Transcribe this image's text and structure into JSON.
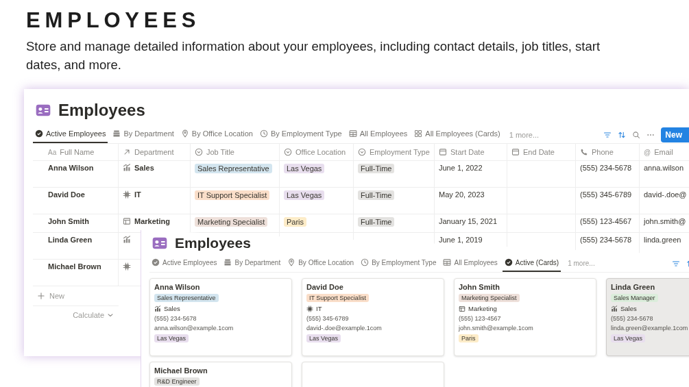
{
  "header": {
    "title": "EMPLOYEES",
    "description": "Store and manage detailed information about your employees, including contact details, job titles, start dates, and more."
  },
  "database": {
    "title": "Employees",
    "views": [
      {
        "label": "Active Employees",
        "selected": true
      },
      {
        "label": "By Department",
        "selected": false
      },
      {
        "label": "By Office Location",
        "selected": false
      },
      {
        "label": "By Employment Type",
        "selected": false
      },
      {
        "label": "All Employees",
        "selected": false
      },
      {
        "label": "All Employees (Cards)",
        "selected": false
      }
    ],
    "more": "1 more...",
    "new_button": "New",
    "columns": [
      {
        "label": "Full Name",
        "kind": "text",
        "prefix": "Aa"
      },
      {
        "label": "Department",
        "kind": "relation"
      },
      {
        "label": "Job Title",
        "kind": "select"
      },
      {
        "label": "Office Location",
        "kind": "select"
      },
      {
        "label": "Employment Type",
        "kind": "select"
      },
      {
        "label": "Start Date",
        "kind": "date"
      },
      {
        "label": "End Date",
        "kind": "date"
      },
      {
        "label": "Phone",
        "kind": "phone"
      },
      {
        "label": "Email",
        "kind": "email",
        "prefix": "@"
      }
    ],
    "rows": [
      {
        "name": "Anna Wilson",
        "department": {
          "label": "Sales",
          "kind": "sales"
        },
        "job_title": {
          "label": "Sales Representative",
          "color": "#d3e5ef"
        },
        "office": {
          "label": "Las Vegas",
          "color": "#e8deee"
        },
        "employment_type": {
          "label": "Full-Time",
          "color": "#e3e2e0"
        },
        "start_date": "June 1, 2022",
        "phone": "(555) 234-5678",
        "email": "anna.wilson"
      },
      {
        "name": "David Doe",
        "department": {
          "label": "IT",
          "kind": "it"
        },
        "job_title": {
          "label": "IT Support Specialist",
          "color": "#fadec9"
        },
        "office": {
          "label": "Las Vegas",
          "color": "#e8deee"
        },
        "employment_type": {
          "label": "Full-Time",
          "color": "#e3e2e0"
        },
        "start_date": "May 20, 2023",
        "phone": "(555) 345-6789",
        "email": "david-.doe@"
      },
      {
        "name": "John Smith",
        "department": {
          "label": "Marketing",
          "kind": "marketing"
        },
        "job_title": {
          "label": "Marketing Specialist",
          "color": "#eee0da"
        },
        "office": {
          "label": "Paris",
          "color": "#fdecc8"
        },
        "employment_type": {
          "label": "Full-Time",
          "color": "#e3e2e0"
        },
        "start_date": "January 15, 2021",
        "phone": "(555) 123-4567",
        "email": "john.smith@"
      },
      {
        "name": "Linda Green",
        "department": {
          "kind": "sales"
        },
        "start_date": "June 1, 2019",
        "phone": "(555) 234-5678",
        "email": "linda.green"
      },
      {
        "name": "Michael Brown",
        "department": {
          "kind": "it"
        }
      }
    ],
    "add_row": "New",
    "calculate": "Calculate"
  },
  "overlay": {
    "title": "Employees",
    "views": [
      {
        "label": "Active Employees",
        "selected": false
      },
      {
        "label": "By Department",
        "selected": false
      },
      {
        "label": "By Office Location",
        "selected": false
      },
      {
        "label": "By Employment Type",
        "selected": false
      },
      {
        "label": "All Employees",
        "selected": false
      },
      {
        "label": "Active (Cards)",
        "selected": true
      }
    ],
    "more": "1 more...",
    "cards": [
      {
        "kind": "person",
        "hovered": false,
        "name": "Anna Wilson",
        "job_title": {
          "label": "Sales Representative",
          "color": "#d3e5ef"
        },
        "department": {
          "label": "Sales",
          "kind": "sales"
        },
        "phone": "(555) 234-5678",
        "email": "anna.wilson@example.1com",
        "office": {
          "label": "Las Vegas",
          "color": "#e8deee"
        }
      },
      {
        "kind": "person",
        "hovered": false,
        "name": "David Doe",
        "job_title": {
          "label": "IT Support Specialist",
          "color": "#fadec9"
        },
        "department": {
          "label": "IT",
          "kind": "it"
        },
        "phone": "(555) 345-6789",
        "email": "david-.doe@example.1com",
        "office": {
          "label": "Las Vegas",
          "color": "#e8deee"
        }
      },
      {
        "kind": "person",
        "hovered": false,
        "name": "John Smith",
        "job_title": {
          "label": "Marketing Specialist",
          "color": "#eee0da"
        },
        "department": {
          "label": "Marketing",
          "kind": "marketing"
        },
        "phone": "(555) 123-4567",
        "email": "john.smith@example.1com",
        "office": {
          "label": "Paris",
          "color": "#fdecc8"
        }
      },
      {
        "kind": "person",
        "hovered": true,
        "name": "Linda Green",
        "job_title": {
          "label": "Sales Manager",
          "color": "#dbeddb"
        },
        "department": {
          "label": "Sales",
          "kind": "sales"
        },
        "phone": "(555) 234-5678",
        "email": "linda.green@example.1com",
        "office": {
          "label": "Las Vegas",
          "color": "#e8deee"
        }
      },
      {
        "kind": "person",
        "hovered": false,
        "name": "Michael Brown",
        "job_title": {
          "label": "R&D Engineer",
          "color": "#e3e2e0"
        }
      },
      {
        "kind": "blank",
        "hovered": false
      }
    ]
  }
}
